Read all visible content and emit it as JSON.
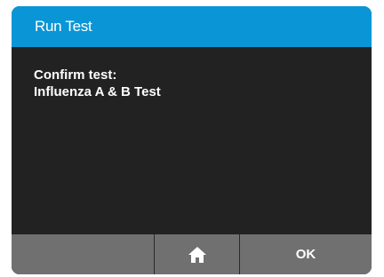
{
  "dialog": {
    "title": "Run Test",
    "message_line1": "Confirm test:",
    "message_line2": "Influenza A & B Test"
  },
  "buttons": {
    "home_icon": "home-icon",
    "ok_label": "OK"
  },
  "colors": {
    "title_bar": "#0a96d6",
    "background": "#222222",
    "button": "#707070",
    "text": "#ffffff"
  }
}
